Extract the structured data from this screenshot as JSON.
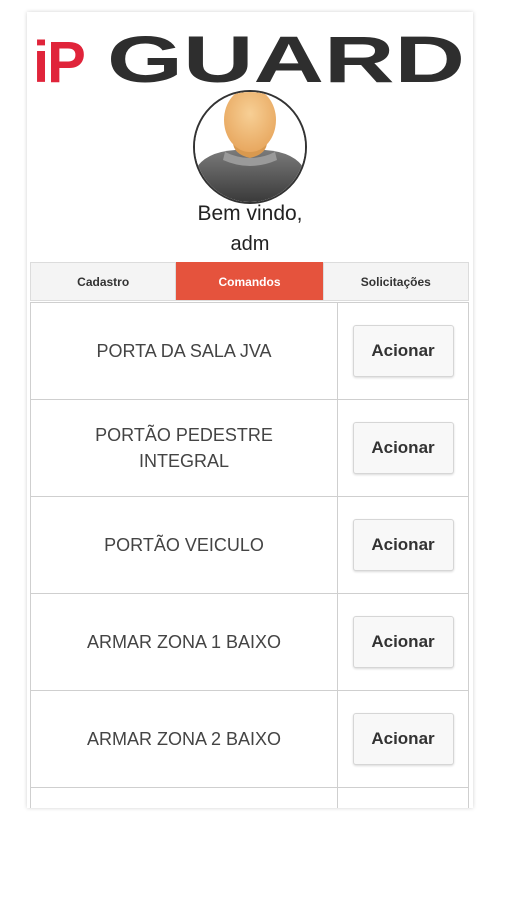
{
  "brand": {
    "logo_prefix": "iP",
    "logo_main": "GUARD",
    "accent_color": "#e5533d"
  },
  "welcome": {
    "line1": "Bem vindo,",
    "line2": "adm"
  },
  "tabs": [
    {
      "label": "Cadastro",
      "active": false
    },
    {
      "label": "Comandos",
      "active": true
    },
    {
      "label": "Solicitações",
      "active": false
    }
  ],
  "commands": [
    {
      "name": "PORTA DA SALA JVA",
      "action": "Acionar"
    },
    {
      "name": "PORTÃO PEDESTRE\nINTEGRAL",
      "action": "Acionar"
    },
    {
      "name": "PORTÃO VEICULO",
      "action": "Acionar"
    },
    {
      "name": "ARMAR ZONA 1 BAIXO",
      "action": "Acionar"
    },
    {
      "name": "ARMAR ZONA 2 BAIXO",
      "action": "Acionar"
    },
    {
      "name": "",
      "action": ""
    }
  ]
}
